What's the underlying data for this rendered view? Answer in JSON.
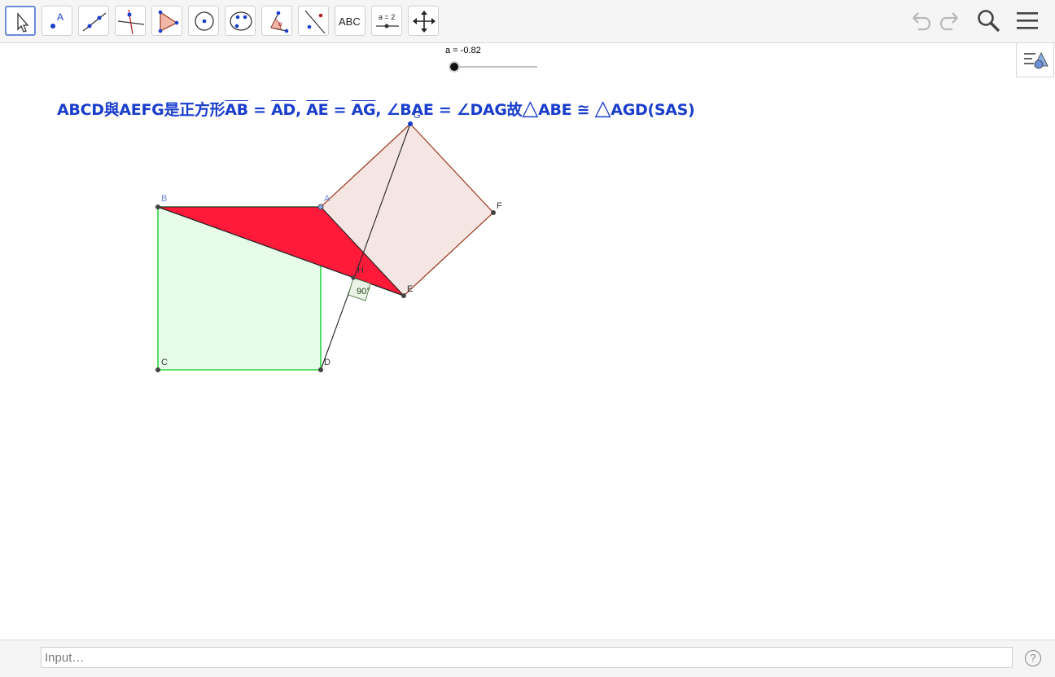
{
  "toolbar": {
    "tools": [
      {
        "name": "move-tool",
        "icon": "arrow-cursor-icon"
      },
      {
        "name": "point-tool",
        "icon": "point-icon",
        "label": "A"
      },
      {
        "name": "line-tool",
        "icon": "line-icon"
      },
      {
        "name": "perpendicular-tool",
        "icon": "perpendicular-line-icon"
      },
      {
        "name": "polygon-tool",
        "icon": "polygon-icon"
      },
      {
        "name": "circle-tool",
        "icon": "circle-icon"
      },
      {
        "name": "conic-tool",
        "icon": "ellipse-icon"
      },
      {
        "name": "angle-tool",
        "icon": "angle-icon"
      },
      {
        "name": "reflect-tool",
        "icon": "reflect-icon"
      },
      {
        "name": "text-tool",
        "icon": "text-icon",
        "label": "ABC"
      },
      {
        "name": "slider-tool",
        "icon": "slider-icon",
        "label": "a = 2"
      },
      {
        "name": "move-graphics-tool",
        "icon": "move-arrows-icon"
      }
    ],
    "right": [
      "undo-icon",
      "redo-icon",
      "search-icon",
      "menu-icon"
    ]
  },
  "slider": {
    "label": "a = -0.82",
    "value": -0.82
  },
  "formula": {
    "p1": "ABCD與AEFG是正方形",
    "ab": "AB",
    "eq1": " = ",
    "ad": "AD",
    "comma1": ", ",
    "ae": "AE",
    "eq2": " = ",
    "ag": "AG",
    "comma2": ", ",
    "angle1": "∠BAE = ∠DAG故",
    "tri1": "△",
    "abe": "ABE ≅ ",
    "tri2": "△",
    "agd": "AGD(SAS)"
  },
  "points": {
    "A": "A",
    "B": "B",
    "C": "C",
    "D": "D",
    "E": "E",
    "F": "F",
    "G": "G",
    "H": "H"
  },
  "angle_label": "90°",
  "input": {
    "placeholder": "Input…"
  },
  "help": "?",
  "colors": {
    "formula": "#1a3ecc",
    "triangle": "#ff1a3a",
    "square_abcd": "#2ed646",
    "square_aefg": "#9b3a20"
  }
}
